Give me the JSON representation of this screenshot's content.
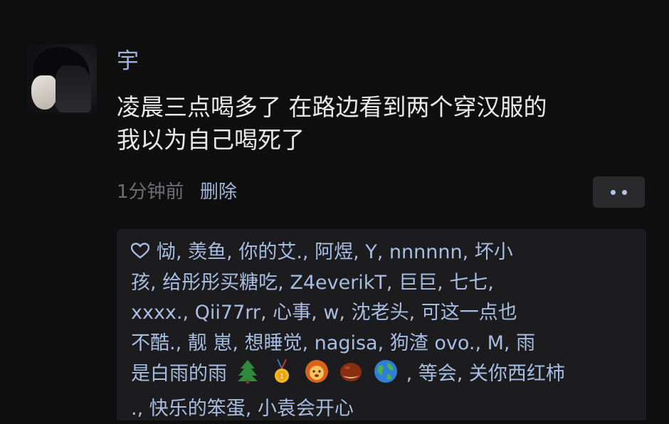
{
  "post": {
    "username": "宇",
    "content_lines": [
      "凌晨三点喝多了 在路边看到两个穿汉服的",
      "我以为自己喝死了"
    ],
    "time": "1分钟前",
    "delete_label": "删除"
  },
  "likes": {
    "lines": [
      "恸, 羡鱼, 你的艾., 阿煜, Y, nnnnnn, 坏小",
      "孩, 给彤彤买糖吃, Z4everikT, 巨巨, 七七,",
      "xxxx., Qii77rr, 心事, w, 沈老头, 可这一点也",
      "不酷., 靓 崽, 想睡觉, nagisa, 狗渣 ovo., M, 雨",
      "是白雨的雨",
      ", 等会, 关你西红柿",
      "., 快乐的笨蛋, 小袁会开心"
    ],
    "emoji_icons": [
      "tree-emoji",
      "medal-emoji",
      "lion-emoji",
      "chestnut-emoji",
      "globe-emoji"
    ]
  },
  "colors": {
    "background": "#0f0f10",
    "name_blue": "#9fb5d9",
    "likes_bg": "#1c1c1e",
    "time_gray": "#6f6f73"
  }
}
